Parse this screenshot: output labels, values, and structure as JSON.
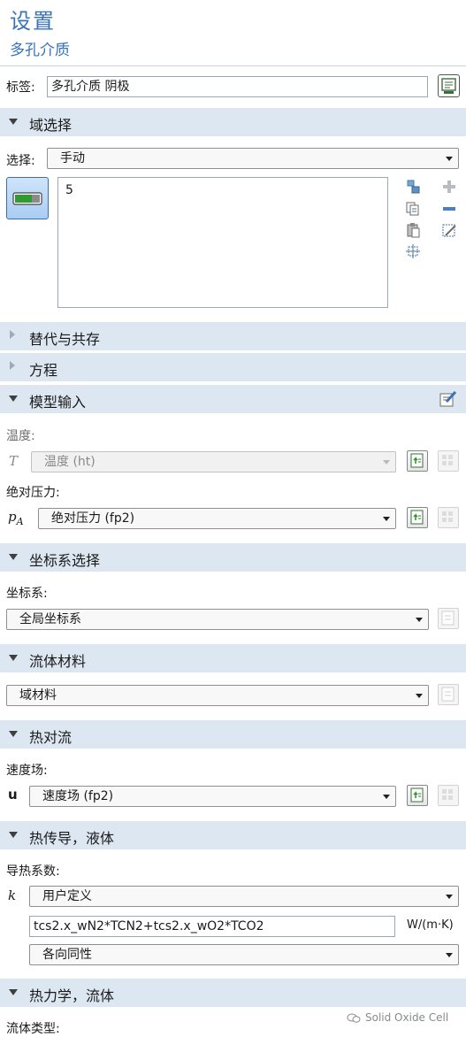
{
  "header": {
    "title": "设置",
    "subtitle": "多孔介质"
  },
  "label_row": {
    "label": "标签:",
    "value": "多孔介质 阴极"
  },
  "sections": {
    "domain": "域选择",
    "override": "替代与共存",
    "equation": "方程",
    "model_input": "模型输入",
    "coord": "坐标系选择",
    "fluid_material": "流体材料",
    "heat_convection": "热对流",
    "heat_conduction": "热传导，液体",
    "thermo": "热力学，流体"
  },
  "domain_selection": {
    "select_label": "选择:",
    "select_value": "手动",
    "items": [
      "5"
    ]
  },
  "model_input": {
    "temperature_label": "温度:",
    "temperature_symbol": "T",
    "temperature_value": "温度 (ht)",
    "pressure_label": "绝对压力:",
    "pressure_symbol": "p",
    "pressure_sub": "A",
    "pressure_value": "绝对压力 (fp2)"
  },
  "coord": {
    "label": "坐标系:",
    "value": "全局坐标系"
  },
  "fluid_material": {
    "value": "域材料"
  },
  "heat_convection": {
    "label": "速度场:",
    "symbol": "u",
    "value": "速度场 (fp2)"
  },
  "heat_conduction": {
    "label": "导热系数:",
    "symbol": "k",
    "mode": "用户定义",
    "expression": "tcs2.x_wN2*TCN2+tcs2.x_wO2*TCO2",
    "unit": "W/(m·K)",
    "isotropy": "各向同性"
  },
  "thermo": {
    "label": "流体类型:"
  },
  "watermark": "Solid Oxide Cell",
  "colors": {
    "accent": "#3a72b8",
    "section_bg": "#dde7f2"
  }
}
